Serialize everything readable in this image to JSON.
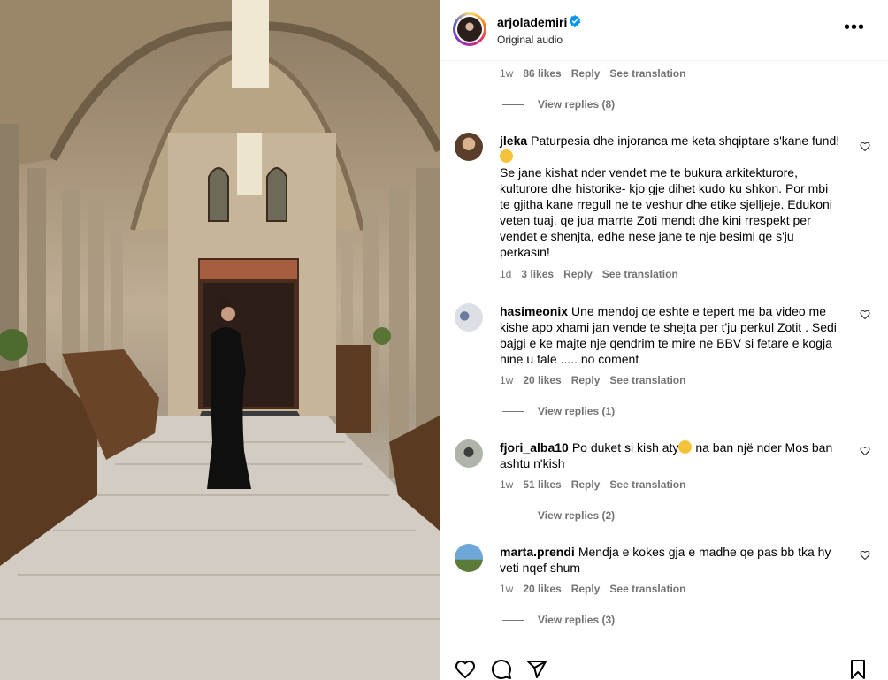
{
  "post": {
    "username": "arjolademiri",
    "subtitle": "Original audio",
    "more_label": "•••"
  },
  "first_block": {
    "time": "1w",
    "likes": "86 likes",
    "reply": "Reply",
    "translation": "See translation",
    "view_replies": "View replies (8)"
  },
  "comments": [
    {
      "username": "jleka",
      "text_line1": "Paturpesia dhe injoranca me keta shqiptare s'kane fund!",
      "emoji": "😣",
      "text_rest": "Se jane kishat nder vendet me te bukura arkitekturore, kulturore dhe historike- kjo gje dihet kudo ku shkon. Por mbi te gjitha kane rregull ne te veshur dhe etike sjelljeje. Edukoni veten tuaj, qe jua marrte Zoti mendt dhe kini rrespekt per vendet e shenjta, edhe nese jane te nje besimi qe s'ju perkasin!",
      "time": "1d",
      "likes": "3 likes",
      "reply": "Reply",
      "translation": "See translation"
    },
    {
      "username": "hasimeonix",
      "text": "Une mendoj qe eshte e tepert me ba video me kishe apo xhami jan vende te shejta per t'ju perkul Zotit . Sedi bajgi e ke majte nje qendrim te mire ne BBV si fetare e kogja hine u fale ..... no coment",
      "time": "1w",
      "likes": "20 likes",
      "reply": "Reply",
      "translation": "See translation",
      "view_replies": "View replies (1)"
    },
    {
      "username": "fjori_alba10",
      "text_before": "Po duket si kish aty",
      "emoji": "🤔",
      "text_after": " na ban një nder Mos ban ashtu n'kish",
      "time": "1w",
      "likes": "51 likes",
      "reply": "Reply",
      "translation": "See translation",
      "view_replies": "View replies (2)"
    },
    {
      "username": "marta.prendi",
      "text": "Mendja e kokes gja e madhe qe pas bb tka hy veti nqef shum",
      "time": "1w",
      "likes": "20 likes",
      "reply": "Reply",
      "translation": "See translation",
      "view_replies": "View replies (3)"
    }
  ],
  "icons": {
    "like": "heart-icon",
    "comment": "comment-icon",
    "share": "share-icon",
    "save": "bookmark-icon"
  },
  "colors": {
    "verified": "#0095f6",
    "secondary_text": "#737373"
  }
}
